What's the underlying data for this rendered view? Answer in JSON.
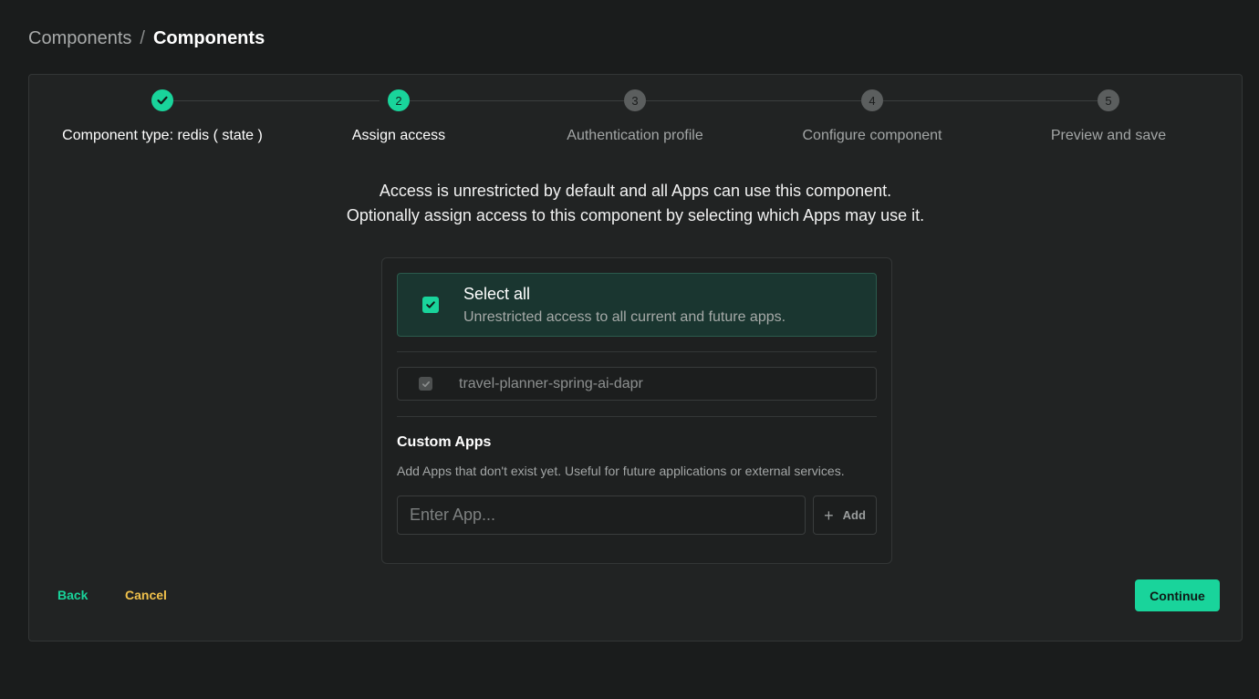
{
  "breadcrumb": {
    "parent": "Components",
    "separator": "/",
    "current": "Components"
  },
  "steps": [
    {
      "number": "1",
      "label": "Component type: redis ( state )",
      "status": "done"
    },
    {
      "number": "2",
      "label": "Assign access",
      "status": "active"
    },
    {
      "number": "3",
      "label": "Authentication profile",
      "status": "pending"
    },
    {
      "number": "4",
      "label": "Configure component",
      "status": "pending"
    },
    {
      "number": "5",
      "label": "Preview and save",
      "status": "pending"
    }
  ],
  "intro": {
    "line1": "Access is unrestricted by default and all Apps can use this component.",
    "line2": "Optionally assign access to this component by selecting which Apps may use it."
  },
  "select_all": {
    "title": "Select all",
    "description": "Unrestricted access to all current and future apps.",
    "checked": true
  },
  "apps": [
    {
      "name": "travel-planner-spring-ai-dapr",
      "checked": true,
      "disabled": true
    }
  ],
  "custom_apps": {
    "title": "Custom Apps",
    "description": "Add Apps that don't exist yet. Useful for future applications or external services.",
    "input_placeholder": "Enter App...",
    "add_label": "Add"
  },
  "actions": {
    "back": "Back",
    "cancel": "Cancel",
    "continue": "Continue"
  },
  "colors": {
    "accent": "#19d49b",
    "warning": "#f0c14b",
    "background": "#1a1c1c"
  }
}
